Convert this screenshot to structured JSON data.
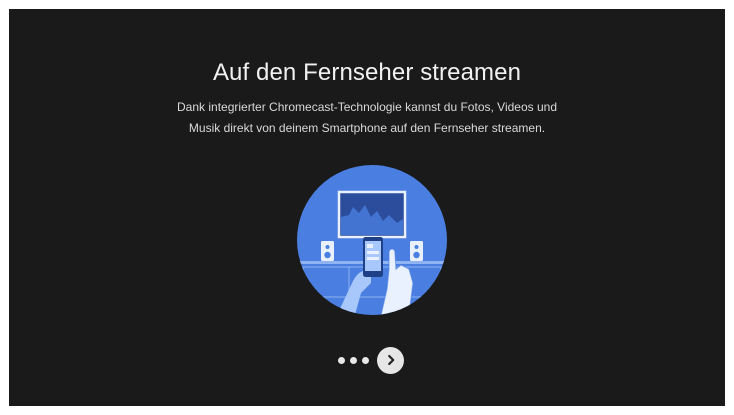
{
  "onboarding": {
    "title": "Auf den Fernseher streamen",
    "description_line1": "Dank integrierter Chromecast-Technologie kannst du Fotos, Videos und",
    "description_line2": "Musik direkt von deinem Smartphone auf den Fernseher streamen."
  },
  "pagination": {
    "total_dots": 3,
    "next_icon": "chevron-right-icon"
  },
  "colors": {
    "background": "#1a1a1a",
    "circle": "#4a7ee0",
    "accent_dark": "#2c4d9b",
    "accent_light": "#a8c7fa"
  }
}
